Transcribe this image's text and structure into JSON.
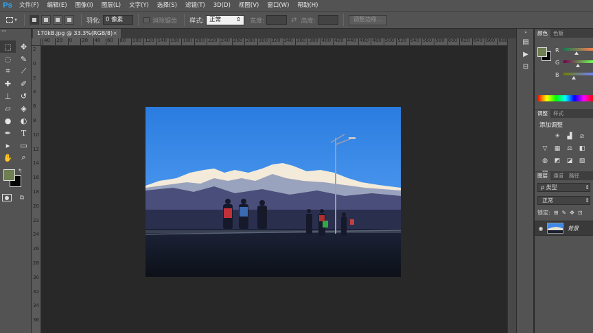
{
  "app": {
    "logo": "Ps"
  },
  "menu": [
    "文件(F)",
    "编辑(E)",
    "图像(I)",
    "图层(L)",
    "文字(Y)",
    "选择(S)",
    "滤镜(T)",
    "3D(D)",
    "视图(V)",
    "窗口(W)",
    "帮助(H)"
  ],
  "options": {
    "feather_label": "羽化:",
    "feather_value": "0 像素",
    "antialias_label": "消除锯齿",
    "style_label": "样式:",
    "style_value": "正常",
    "width_label": "宽度:",
    "height_label": "高度:",
    "refine_edge": "调整边缘..."
  },
  "document": {
    "tab_title": "170kB.jpg @ 33.3%(RGB/8)",
    "close": "×"
  },
  "ruler": {
    "h_ticks": [
      "40",
      "20",
      "0",
      "20",
      "40",
      "60",
      "80",
      "100",
      "120",
      "140",
      "160",
      "180",
      "200",
      "220",
      "240",
      "260",
      "280",
      "300",
      "320",
      "340",
      "360",
      "380",
      "400",
      "420",
      "440",
      "460",
      "480",
      "500",
      "520",
      "540",
      "560",
      "580",
      "600",
      "620",
      "640",
      "660",
      "680"
    ],
    "v_ticks": [
      "2",
      "0",
      "2",
      "4",
      "6",
      "8",
      "10",
      "12",
      "14",
      "16",
      "18",
      "20",
      "22",
      "24",
      "26",
      "28",
      "30",
      "32",
      "34",
      "36"
    ]
  },
  "panels": {
    "color_tabs": [
      "颜色",
      "色板"
    ],
    "channels": [
      "R",
      "G",
      "B"
    ],
    "adjust_tabs": [
      "调整",
      "样式"
    ],
    "adjust_title": "添加调整",
    "layer_tabs": [
      "图层",
      "通道",
      "路径"
    ],
    "layer_kind": "ρ 类型",
    "blend_mode": "正常",
    "lock_label": "锁定:",
    "layer_name": "背景"
  },
  "colors": {
    "foreground": "#6f7f52",
    "background": "#050505",
    "accent": "#31a8ff"
  }
}
